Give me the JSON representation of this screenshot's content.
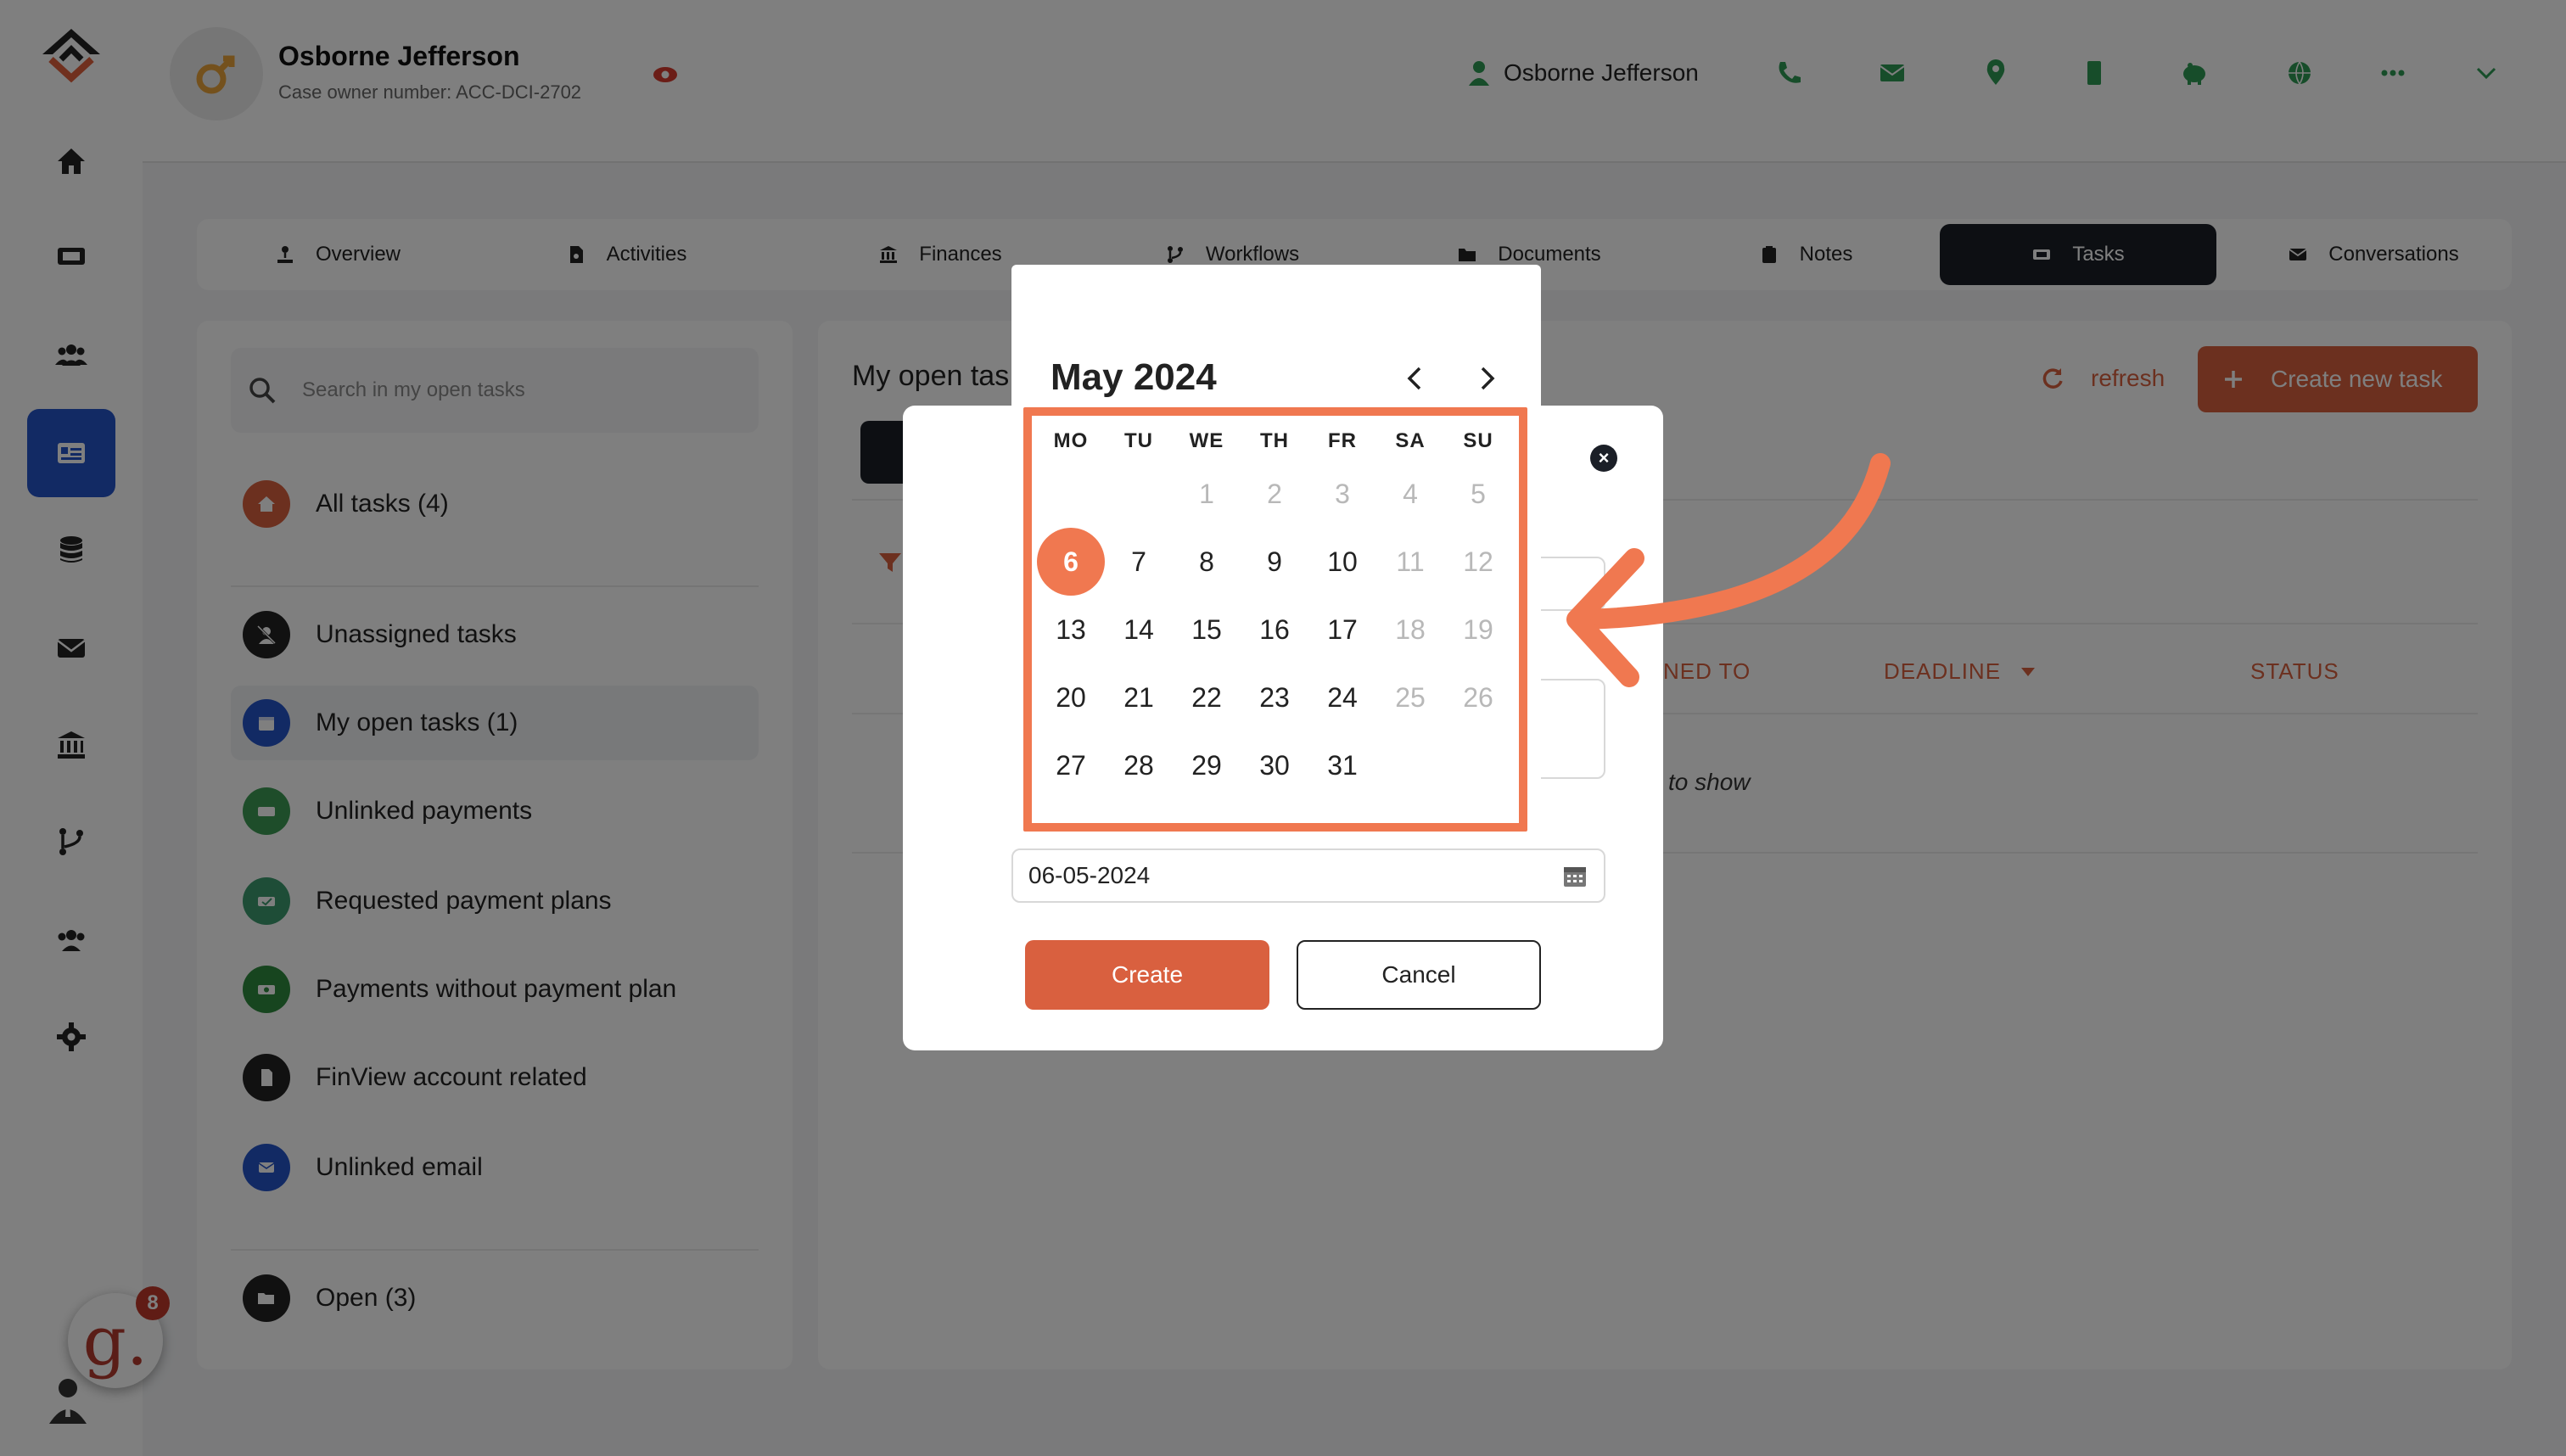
{
  "header": {
    "case_name": "Osborne Jefferson",
    "case_owner": "Case owner number: ACC-DCI-2702",
    "user_name": "Osborne Jefferson"
  },
  "tabs": [
    {
      "label": "Overview",
      "icon": "user-download-icon"
    },
    {
      "label": "Activities",
      "icon": "file-icon"
    },
    {
      "label": "Finances",
      "icon": "bank-icon"
    },
    {
      "label": "Workflows",
      "icon": "branch-icon"
    },
    {
      "label": "Documents",
      "icon": "folder-icon"
    },
    {
      "label": "Notes",
      "icon": "clipboard-icon"
    },
    {
      "label": "Tasks",
      "icon": "tasks-icon",
      "active": true
    },
    {
      "label": "Conversations",
      "icon": "envelope-icon"
    }
  ],
  "left_panel": {
    "search_placeholder": "Search in my open tasks",
    "items": [
      {
        "label": "All tasks (4)",
        "color": "#d9603f"
      },
      {
        "label": "Unassigned tasks",
        "color": "#222222"
      },
      {
        "label": "My open tasks (1)",
        "color": "#2454c9"
      },
      {
        "label": "Unlinked payments",
        "color": "#3d9b55"
      },
      {
        "label": "Requested payment plans",
        "color": "#3d9b6f"
      },
      {
        "label": "Payments without payment plan",
        "color": "#2f8a3e"
      },
      {
        "label": "FinView account related",
        "color": "#222222"
      },
      {
        "label": "Unlinked email",
        "color": "#2454c9"
      },
      {
        "label": "Open (3)",
        "color": "#222222"
      }
    ]
  },
  "main": {
    "title": "My open tas",
    "refresh_label": "refresh",
    "create_label": "Create new task",
    "columns": [
      "NED TO",
      "DEADLINE",
      "STATUS"
    ],
    "empty_message": "to show"
  },
  "modal": {
    "date_value": "06-05-2024",
    "create_label": "Create",
    "cancel_label": "Cancel"
  },
  "calendar": {
    "month_label": "May 2024",
    "weekdays": [
      "MO",
      "TU",
      "WE",
      "TH",
      "FR",
      "SA",
      "SU"
    ],
    "selected_day": 6,
    "weeks": [
      [
        null,
        null,
        1,
        2,
        3,
        4,
        5
      ],
      [
        6,
        7,
        8,
        9,
        10,
        11,
        12
      ],
      [
        13,
        14,
        15,
        16,
        17,
        18,
        19
      ],
      [
        20,
        21,
        22,
        23,
        24,
        25,
        26
      ],
      [
        27,
        28,
        29,
        30,
        31,
        null,
        null
      ]
    ],
    "muted_days": [
      1,
      2,
      3,
      4,
      5,
      11,
      12,
      18,
      19,
      25,
      26
    ]
  },
  "notifications": {
    "count": "8",
    "logo_letter": "g."
  },
  "colors": {
    "accent": "#d9603f",
    "highlight": "#f07850",
    "active_nav": "#2454c9"
  }
}
